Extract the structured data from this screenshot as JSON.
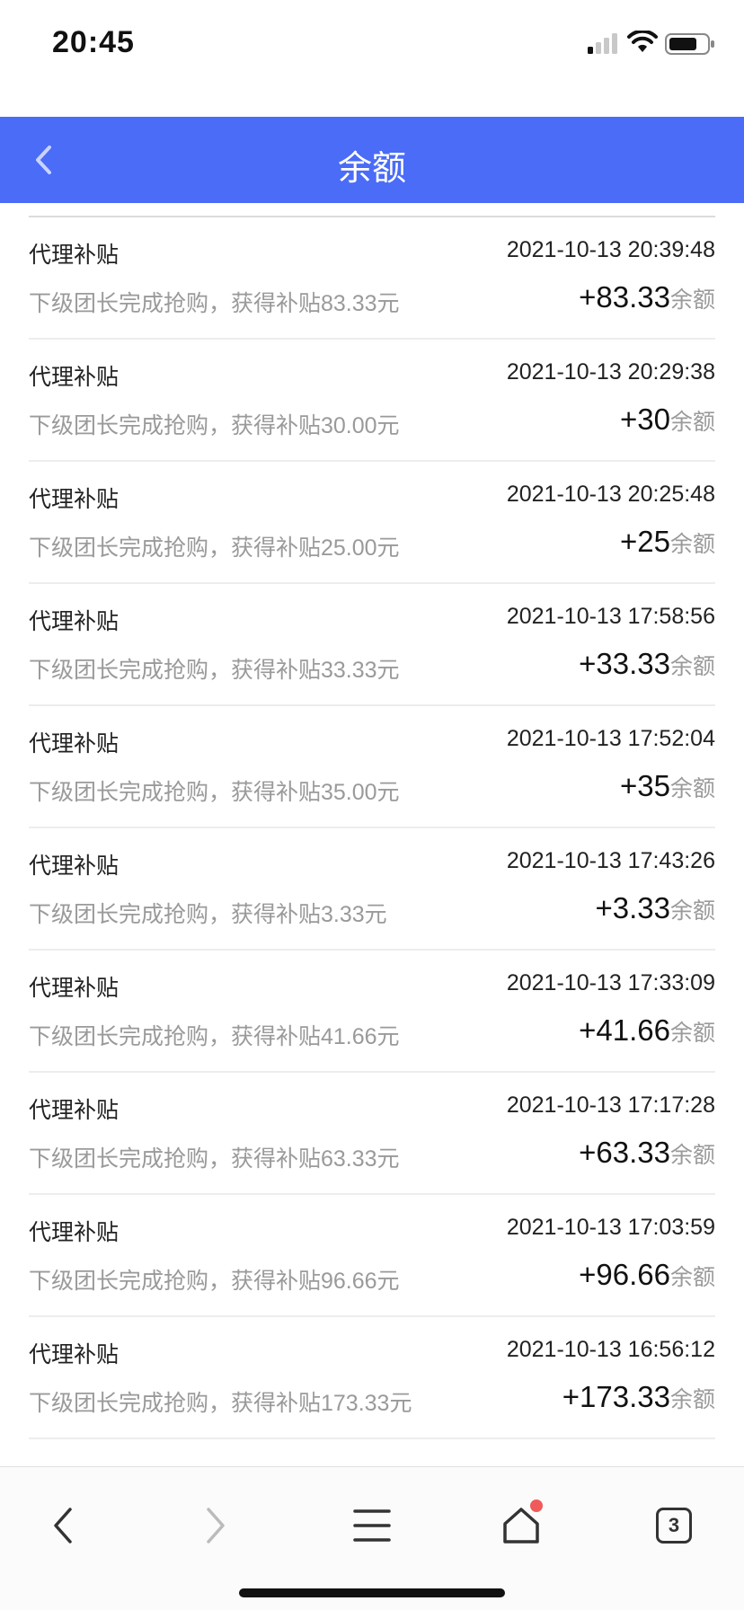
{
  "status_bar": {
    "time": "20:45"
  },
  "nav": {
    "title": "余额"
  },
  "list": {
    "unit_label": "余额",
    "items": [
      {
        "title": "代理补贴",
        "time": "2021-10-13 20:39:48",
        "desc": "下级团长完成抢购，获得补贴83.33元",
        "amount": "+83.33"
      },
      {
        "title": "代理补贴",
        "time": "2021-10-13 20:29:38",
        "desc": "下级团长完成抢购，获得补贴30.00元",
        "amount": "+30"
      },
      {
        "title": "代理补贴",
        "time": "2021-10-13 20:25:48",
        "desc": "下级团长完成抢购，获得补贴25.00元",
        "amount": "+25"
      },
      {
        "title": "代理补贴",
        "time": "2021-10-13 17:58:56",
        "desc": "下级团长完成抢购，获得补贴33.33元",
        "amount": "+33.33"
      },
      {
        "title": "代理补贴",
        "time": "2021-10-13 17:52:04",
        "desc": "下级团长完成抢购，获得补贴35.00元",
        "amount": "+35"
      },
      {
        "title": "代理补贴",
        "time": "2021-10-13 17:43:26",
        "desc": "下级团长完成抢购，获得补贴3.33元",
        "amount": "+3.33"
      },
      {
        "title": "代理补贴",
        "time": "2021-10-13 17:33:09",
        "desc": "下级团长完成抢购，获得补贴41.66元",
        "amount": "+41.66"
      },
      {
        "title": "代理补贴",
        "time": "2021-10-13 17:17:28",
        "desc": "下级团长完成抢购，获得补贴63.33元",
        "amount": "+63.33"
      },
      {
        "title": "代理补贴",
        "time": "2021-10-13 17:03:59",
        "desc": "下级团长完成抢购，获得补贴96.66元",
        "amount": "+96.66"
      },
      {
        "title": "代理补贴",
        "time": "2021-10-13 16:56:12",
        "desc": "下级团长完成抢购，获得补贴173.33元",
        "amount": "+173.33"
      }
    ]
  },
  "browser_toolbar": {
    "tabs_count": "3"
  },
  "icons": {
    "back": "chevron-left-icon",
    "browser_back": "arrow-left-icon",
    "browser_forward": "arrow-right-icon",
    "menu": "menu-icon",
    "home": "home-icon",
    "tabs": "tabs-icon"
  },
  "colors": {
    "nav_bg": "#4a6cf7",
    "notification_dot": "#f05a5a"
  }
}
